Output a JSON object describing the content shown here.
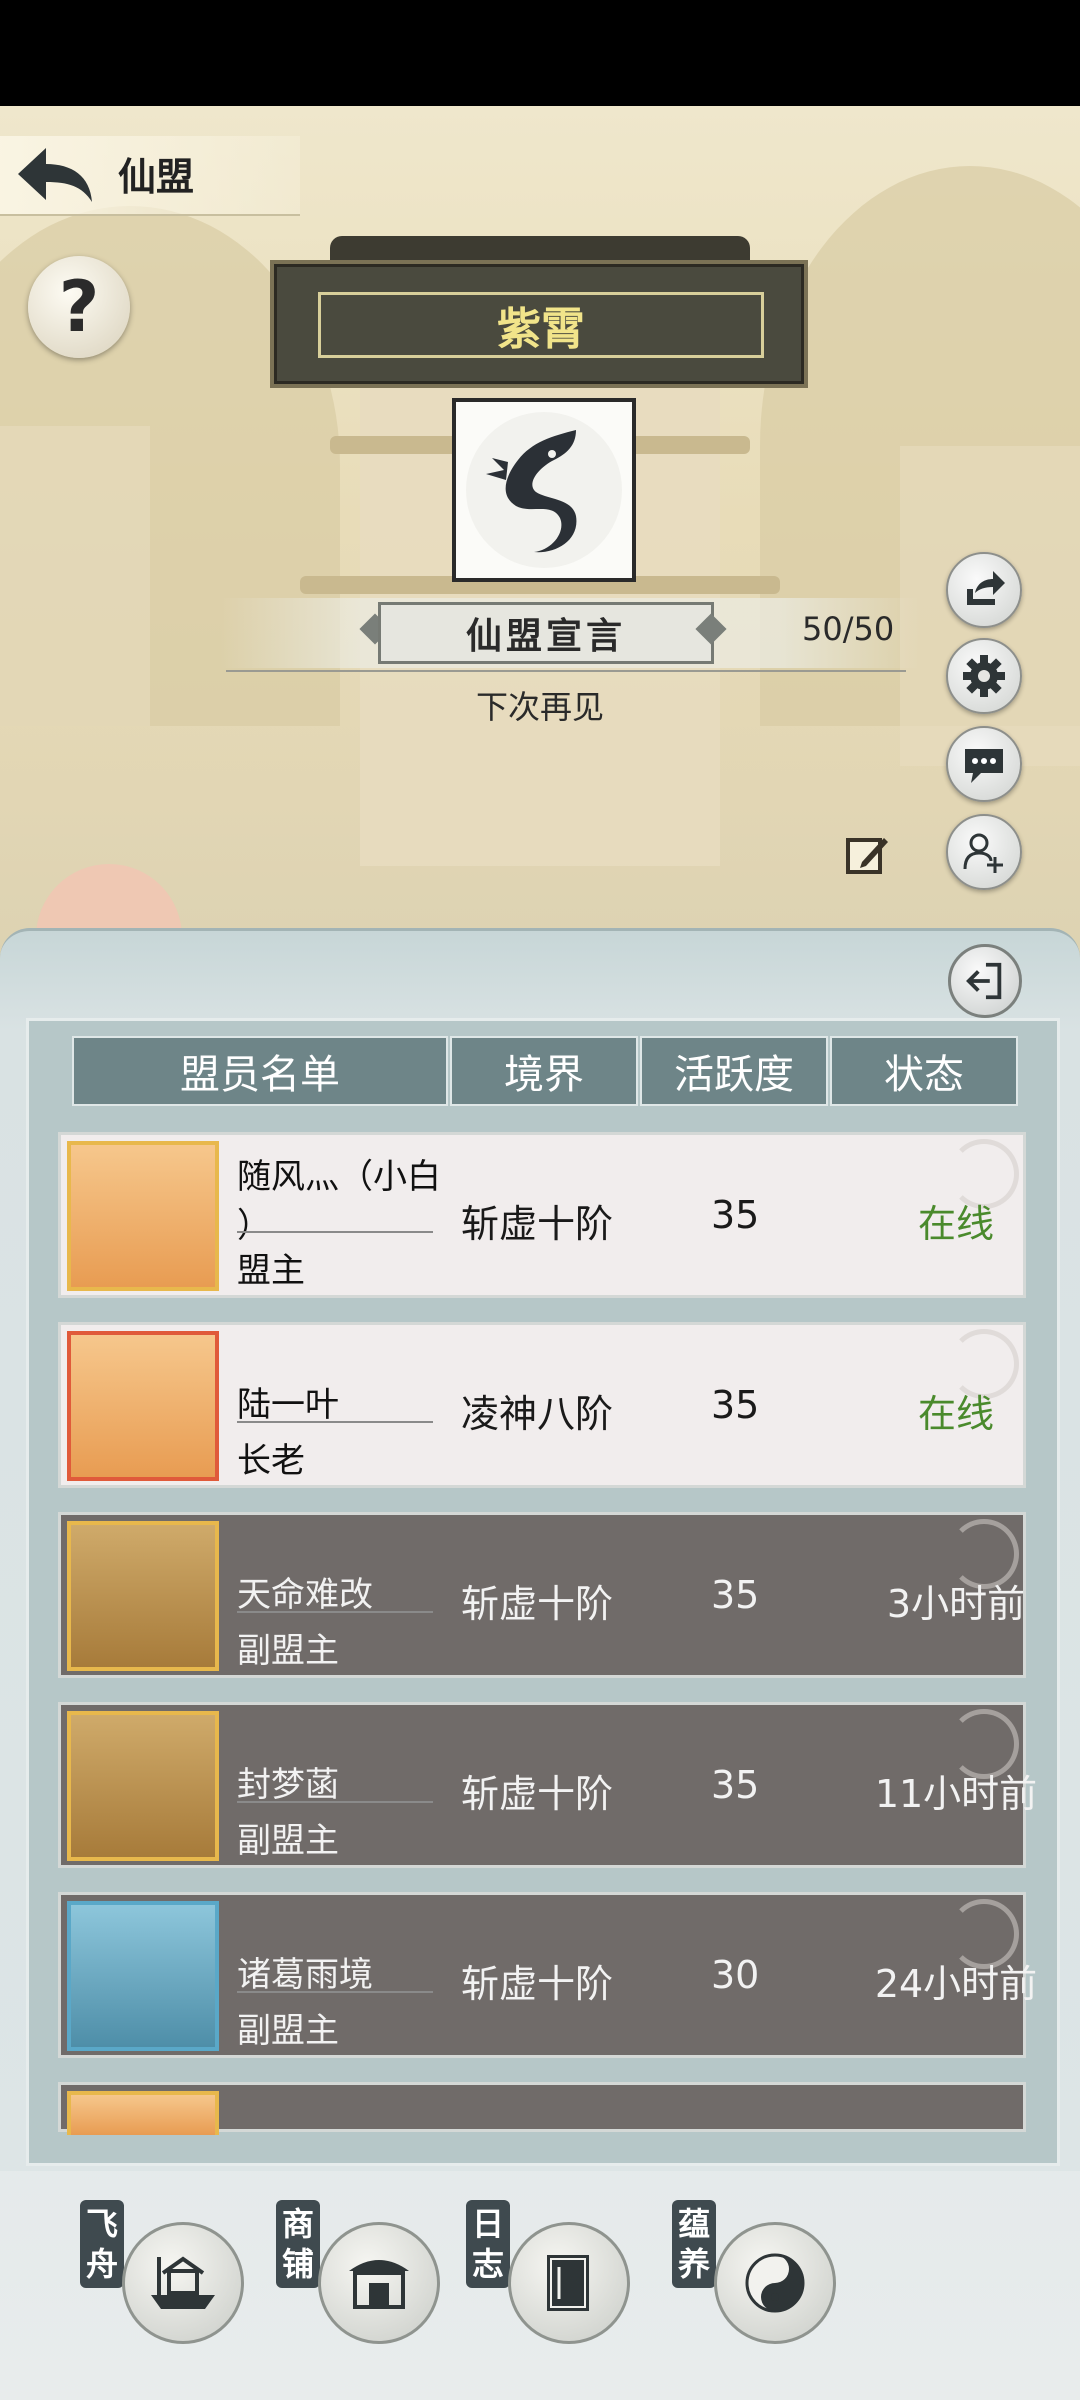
{
  "header": {
    "title": "仙盟",
    "help_label": "?"
  },
  "alliance": {
    "name": "紫霄",
    "emblem_icon": "dragon-emblem"
  },
  "declaration": {
    "title": "仙盟宣言",
    "count": "50/50",
    "text": "下次再见"
  },
  "side_actions": [
    {
      "icon": "share-icon"
    },
    {
      "icon": "gear-icon"
    },
    {
      "icon": "chat-icon"
    },
    {
      "icon": "add-user-icon"
    }
  ],
  "table": {
    "headers": {
      "name": "盟员名单",
      "realm": "境界",
      "activity": "活跃度",
      "status": "状态"
    },
    "rows": [
      {
        "name": "随风灬（小白",
        "name2": "）",
        "role": "盟主",
        "realm": "斩虚十阶",
        "activity": "35",
        "status": "在线",
        "online": true
      },
      {
        "name": "陆一叶",
        "name2": "",
        "role": "长老",
        "realm": "凌神八阶",
        "activity": "35",
        "status": "在线",
        "online": true
      },
      {
        "name": "天命难改",
        "name2": "",
        "role": "副盟主",
        "realm": "斩虚十阶",
        "activity": "35",
        "status": "3小时前",
        "online": false
      },
      {
        "name": "封梦菡",
        "name2": "",
        "role": "副盟主",
        "realm": "斩虚十阶",
        "activity": "35",
        "status": "11小时前",
        "online": false
      },
      {
        "name": "诸葛雨境",
        "name2": "",
        "role": "副盟主",
        "realm": "斩虚十阶",
        "activity": "30",
        "status": "24小时前",
        "online": false
      }
    ]
  },
  "bottom_nav": [
    {
      "tag": "飞舟",
      "icon": "boat-icon"
    },
    {
      "tag": "商铺",
      "icon": "shop-icon"
    },
    {
      "tag": "日志",
      "icon": "book-icon"
    },
    {
      "tag": "蕴养",
      "icon": "yin-yang-icon"
    }
  ],
  "colors": {
    "online": "#4a8a2c",
    "header_bg": "#6e8588",
    "plaque_text": "#f1e48a"
  }
}
